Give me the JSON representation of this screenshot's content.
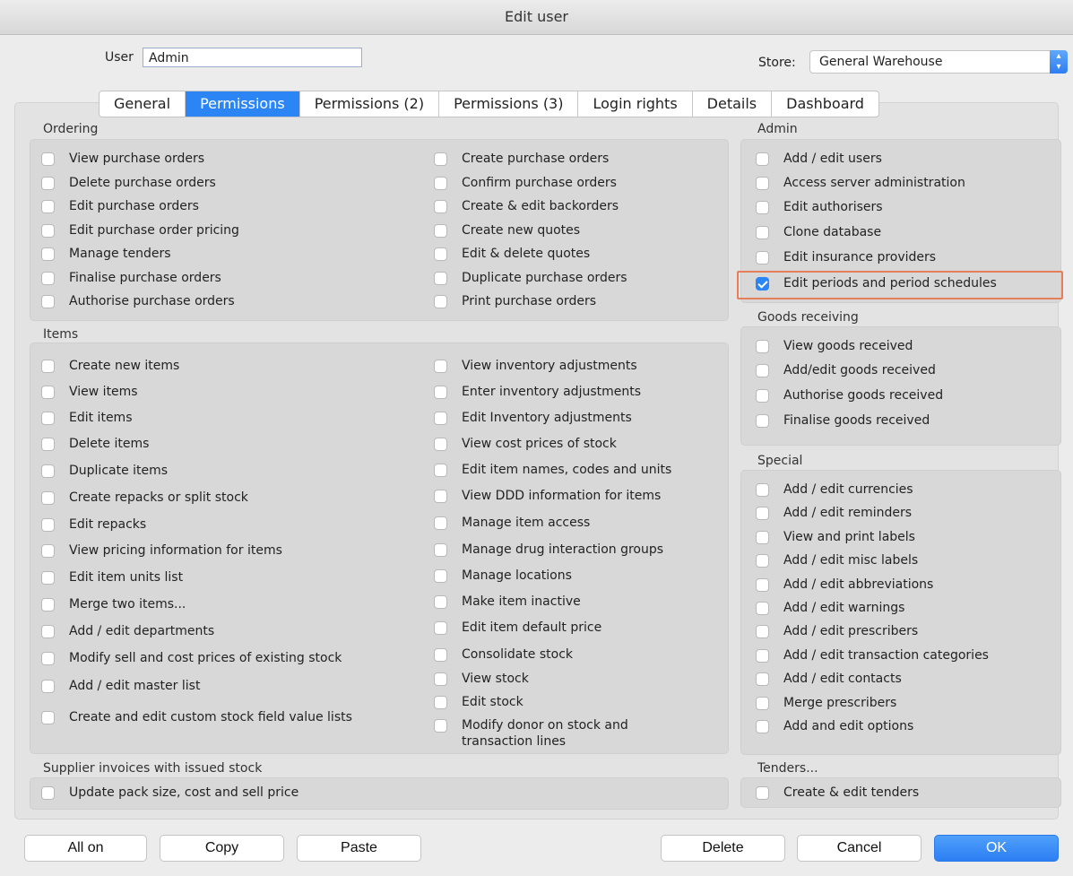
{
  "window": {
    "title": "Edit user"
  },
  "user": {
    "label": "User",
    "value": "Admin"
  },
  "store": {
    "label": "Store:",
    "value": "General Warehouse",
    "arrow_icon": "up-down-chevron-icon"
  },
  "tabs": [
    {
      "label": "General",
      "active": false
    },
    {
      "label": "Permissions",
      "active": true
    },
    {
      "label": "Permissions (2)",
      "active": false
    },
    {
      "label": "Permissions (3)",
      "active": false
    },
    {
      "label": "Login rights",
      "active": false
    },
    {
      "label": "Details",
      "active": false
    },
    {
      "label": "Dashboard",
      "active": false
    }
  ],
  "groups": {
    "ordering": {
      "title": "Ordering",
      "left": [
        "View purchase orders",
        "Delete purchase orders",
        "Edit purchase orders",
        "Edit purchase order pricing",
        "Manage tenders",
        "Finalise purchase orders",
        "Authorise purchase orders"
      ],
      "right": [
        "Create purchase orders",
        "Confirm purchase orders",
        "Create & edit backorders",
        "Create new quotes",
        "Edit & delete quotes",
        "Duplicate purchase orders",
        "Print purchase orders"
      ]
    },
    "items": {
      "title": "Items",
      "left": [
        "Create new items",
        "View items",
        "Edit items",
        "Delete items",
        "Duplicate items",
        "Create repacks or split stock",
        "Edit repacks",
        "View pricing information for items",
        "Edit item units list",
        "Merge two items...",
        "Add / edit departments",
        "Modify sell and cost prices of existing stock",
        "Add / edit master list",
        "Create and edit custom stock field value lists"
      ],
      "right": [
        "View inventory adjustments",
        "Enter inventory adjustments",
        "Edit Inventory adjustments",
        "View cost prices of stock",
        "Edit item names, codes and units",
        "View DDD information for items",
        "Manage item access",
        "Manage drug interaction groups",
        "Manage locations",
        "Make item inactive",
        "Edit item default price",
        "Consolidate stock",
        "View stock",
        "Edit stock",
        "Modify donor on stock and",
        "transaction lines"
      ]
    },
    "supplier": {
      "title": "Supplier invoices with issued stock",
      "items": [
        "Update pack size, cost and sell price"
      ]
    },
    "admin": {
      "title": "Admin",
      "items": [
        "Add / edit users",
        "Access server administration",
        "Edit authorisers",
        "Clone database",
        "Edit insurance providers",
        "Edit periods and period schedules"
      ],
      "checked_index": 5
    },
    "goods": {
      "title": "Goods receiving",
      "items": [
        "View goods received",
        "Add/edit goods received",
        "Authorise goods received",
        "Finalise goods received"
      ]
    },
    "special": {
      "title": "Special",
      "items": [
        "Add / edit currencies",
        "Add / edit reminders",
        "View and print labels",
        "Add / edit misc labels",
        "Add / edit abbreviations",
        "Add / edit warnings",
        "Add / edit prescribers",
        "Add / edit transaction categories",
        "Add / edit contacts",
        "Merge prescribers",
        "Add and edit options"
      ]
    },
    "tenders": {
      "title": "Tenders...",
      "items": [
        "Create & edit tenders"
      ]
    }
  },
  "buttons": {
    "all_on": "All on",
    "copy": "Copy",
    "paste": "Paste",
    "delete": "Delete",
    "cancel": "Cancel",
    "ok": "OK"
  },
  "colors": {
    "accent": "#2c85f5",
    "highlight": "#e57f5a"
  }
}
